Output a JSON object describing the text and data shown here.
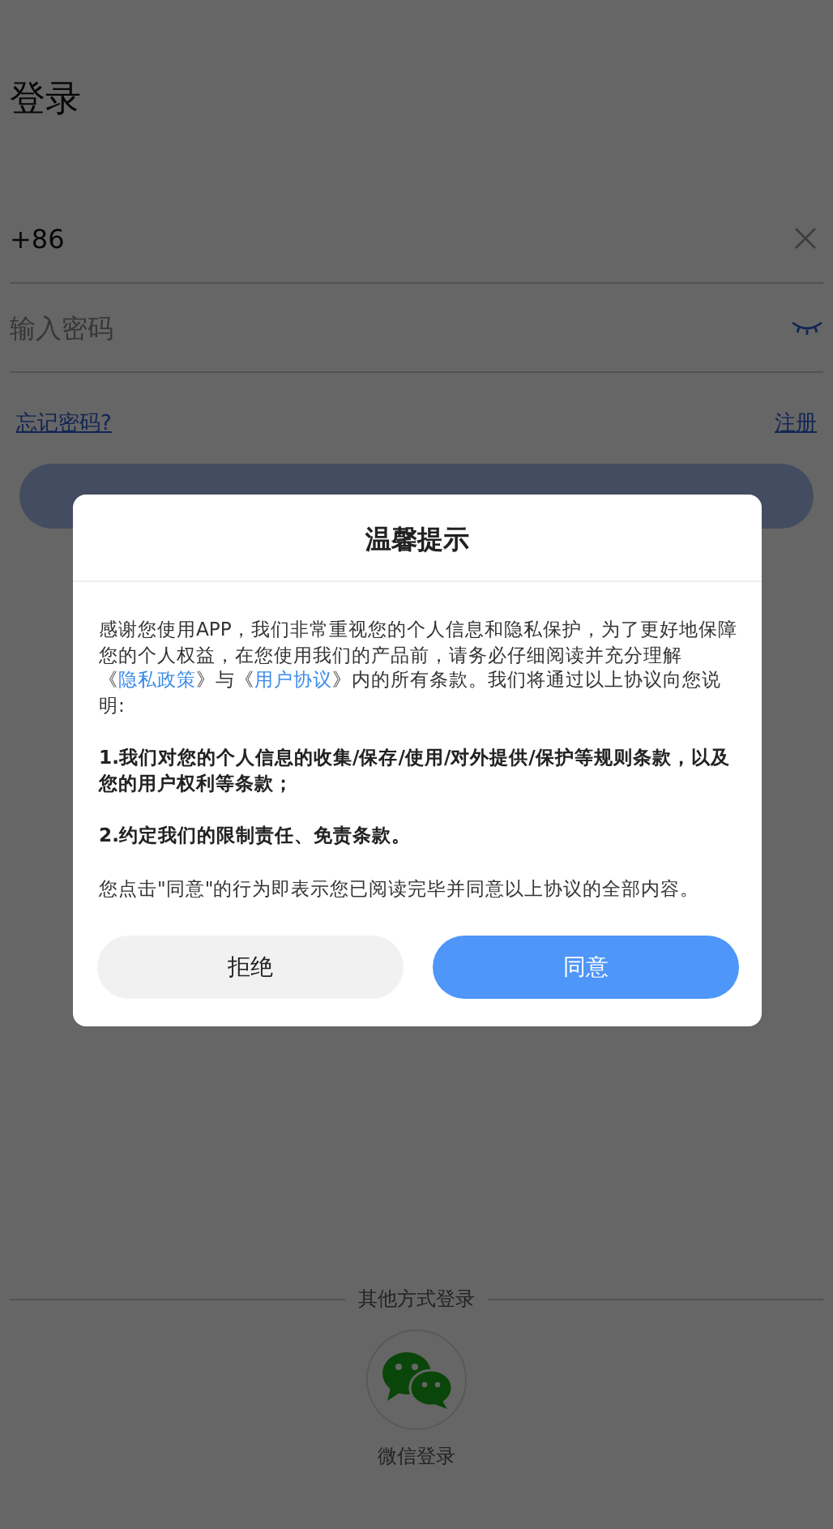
{
  "page_title": "登录",
  "phone_field": {
    "value": "+86"
  },
  "password_field": {
    "placeholder": "输入密码",
    "visible": false
  },
  "forgot_link": "忘记密码?",
  "register_link": "注册",
  "other_login": {
    "label": "其他方式登录",
    "options": [
      {
        "label": "微信登录"
      }
    ]
  },
  "dialog": {
    "title": "温馨提示",
    "intro": [
      {
        "kind": "text",
        "text": "感谢您使用APP，我们非常重视您的个人信息和隐私保护，为了更好地保障您的个人权益，在您使用我们的产品前，请务必仔细阅读并充分理解《"
      },
      {
        "kind": "link",
        "text": "隐私政策"
      },
      {
        "kind": "text",
        "text": "》与《"
      },
      {
        "kind": "link",
        "text": "用户协议"
      },
      {
        "kind": "text",
        "text": "》内的所有条款。我们将通过以上协议向您说明:"
      }
    ],
    "items": [
      "1.我们对您的个人信息的收集/保存/使用/对外提供/保护等规则条款，以及您的用户权利等条款；",
      "2.约定我们的限制责任、免责条款。"
    ],
    "note": "您点击\"同意\"的行为即表示您已阅读完毕并同意以上协议的全部内容。",
    "buttons": [
      {
        "label": "拒绝",
        "primary": false
      },
      {
        "label": "同意",
        "primary": true
      }
    ]
  }
}
